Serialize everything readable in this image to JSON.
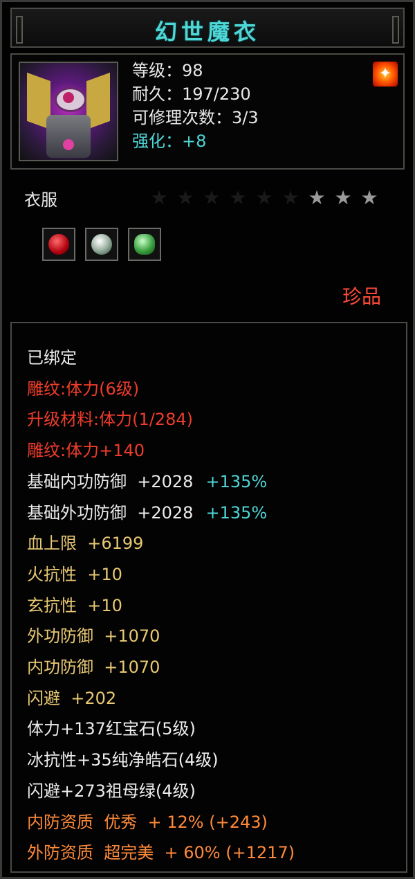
{
  "title": "幻世魔衣",
  "info": {
    "level": "等级：98",
    "durability": "耐久：197/230",
    "repairs": "可修理次数：3/3",
    "enhance": "强化：+8"
  },
  "icons": {
    "portrait": "armor-portrait",
    "fire": "fire-element-icon"
  },
  "category": "衣服",
  "stars": {
    "total": 9,
    "lit": 3
  },
  "gems": [
    "ruby-gem-icon",
    "diamond-gem-icon",
    "emerald-gem-icon"
  ],
  "rarity": "珍品",
  "attributes": [
    {
      "text": "已绑定",
      "color": "white"
    },
    {
      "text": "雕纹:体力(6级)",
      "color": "red"
    },
    {
      "text": "升级材料:体力(1/284)",
      "color": "red"
    },
    {
      "text": "雕纹:体力+140",
      "color": "red"
    },
    {
      "text": "基础内功防御  +2028",
      "pct": "+135%",
      "color": "white"
    },
    {
      "text": "基础外功防御  +2028",
      "pct": "+135%",
      "color": "white"
    },
    {
      "text": "血上限  +6199",
      "color": "gold"
    },
    {
      "text": "火抗性  +10",
      "color": "gold"
    },
    {
      "text": "玄抗性  +10",
      "color": "gold"
    },
    {
      "text": "外功防御  +1070",
      "color": "gold"
    },
    {
      "text": "内功防御  +1070",
      "color": "gold"
    },
    {
      "text": "闪避  +202",
      "color": "gold"
    },
    {
      "text": "体力+137红宝石(5级)",
      "color": "white"
    },
    {
      "text": "冰抗性+35纯净皓石(4级)",
      "color": "white"
    },
    {
      "text": "闪避+273祖母绿(4级)",
      "color": "white"
    },
    {
      "text": "内防资质  优秀  + 12% (+243)",
      "color": "orange"
    },
    {
      "text": "外防资质  超完美  + 60% (+1217)",
      "color": "orange"
    }
  ],
  "colors": {
    "title": "#4fd6d6",
    "white": "#ececec",
    "red": "#f03c2c",
    "gold": "#e8c873",
    "orange": "#ff8a3a",
    "cyan": "#4fd6d6"
  }
}
